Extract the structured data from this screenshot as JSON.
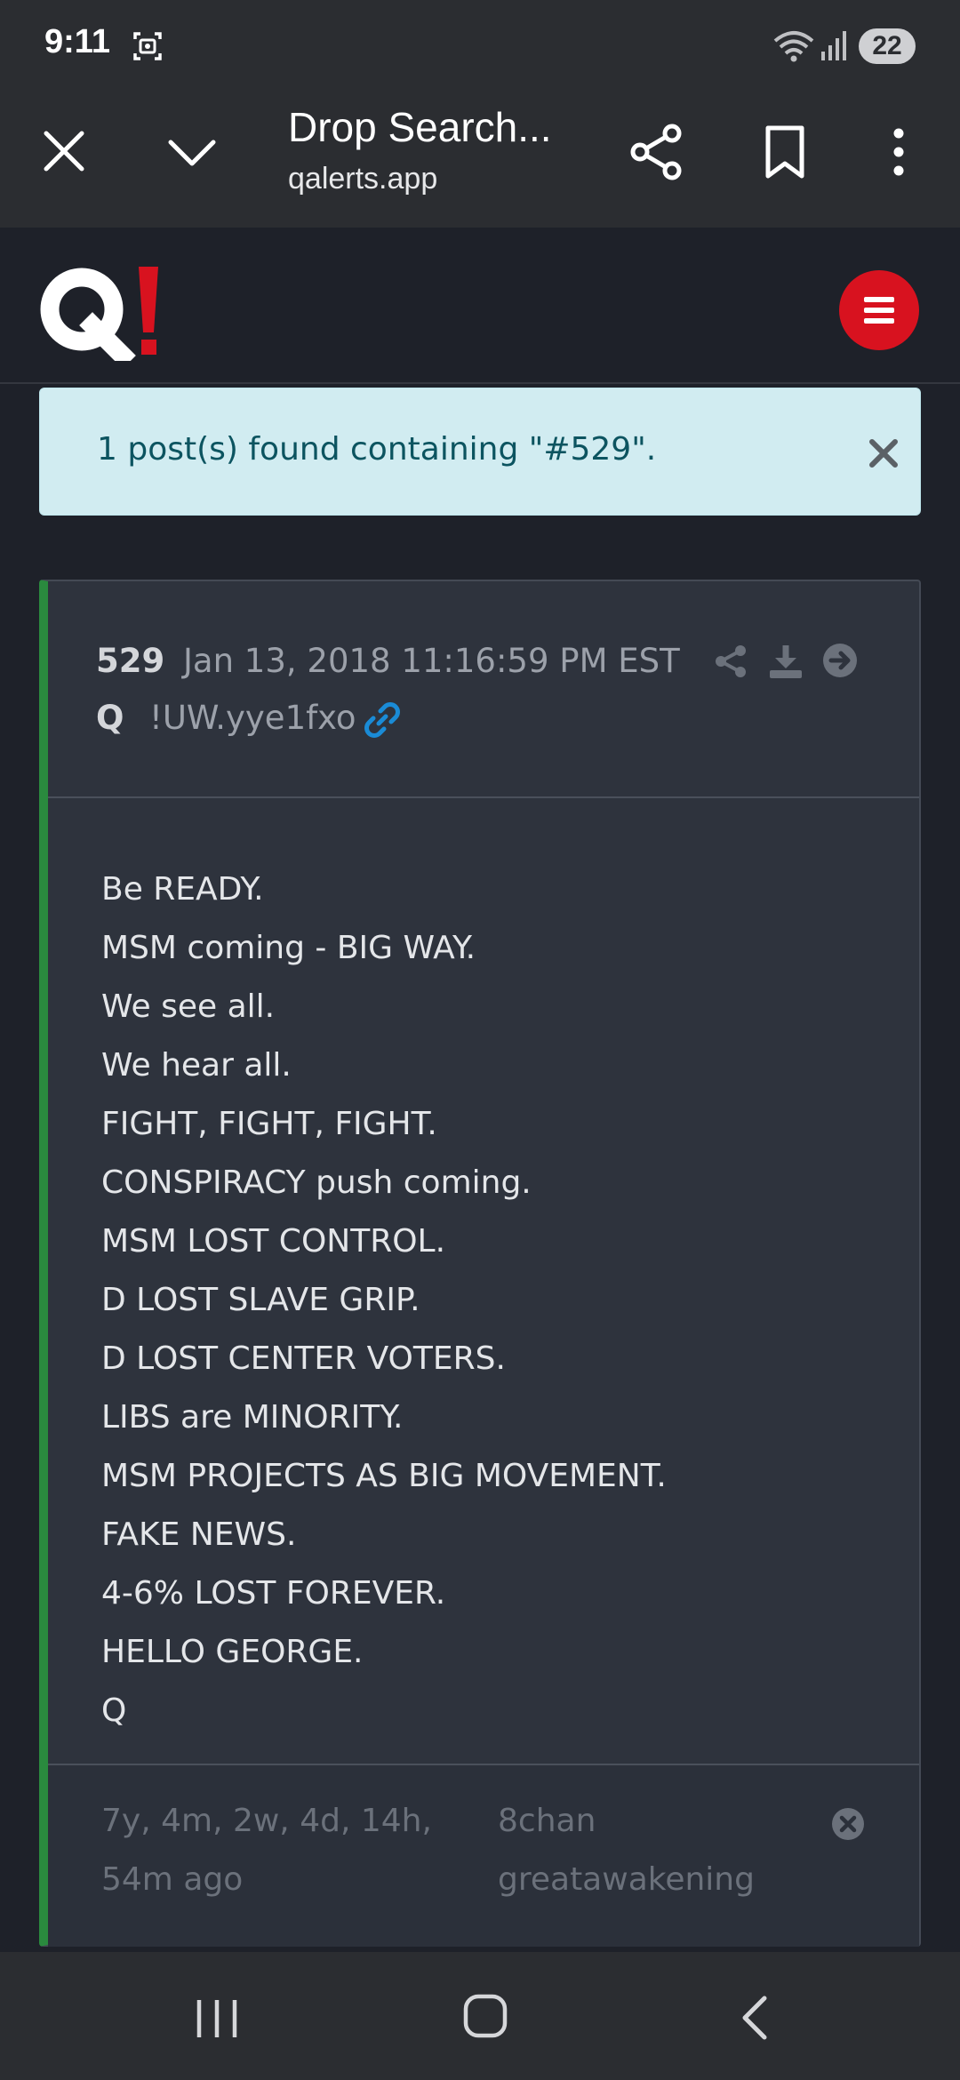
{
  "status_bar": {
    "time": "9:11",
    "battery": "22"
  },
  "browser": {
    "title": "Drop Search...",
    "url": "qalerts.app"
  },
  "alert": {
    "text": "1 post(s) found containing \"#529\"."
  },
  "post": {
    "number": "529",
    "date": "Jan 13, 2018 11:16:59 PM EST",
    "author": "Q",
    "tripcode": "!UW.yye1fxo",
    "lines": [
      "Be READY.",
      "MSM coming - BIG WAY.",
      "We see all.",
      "We hear all.",
      "FIGHT, FIGHT, FIGHT.",
      "CONSPIRACY push coming.",
      "MSM LOST CONTROL.",
      "D LOST SLAVE GRIP.",
      "D LOST CENTER VOTERS.",
      "LIBS are MINORITY.",
      "MSM PROJECTS AS BIG MOVEMENT.",
      "FAKE NEWS.",
      "4-6% LOST FOREVER.",
      "HELLO GEORGE.",
      "Q"
    ],
    "age_line1": "7y, 4m, 2w, 4d, 14h,",
    "age_line2": "54m ago",
    "source_line1": "8chan",
    "source_line2": "greatawakening"
  },
  "colors": {
    "accent_red": "#d8121f",
    "post_border_green": "#2a8a3e",
    "link_blue": "#1a8bd6",
    "alert_bg": "#d1ecf1"
  },
  "icons": {
    "browser": [
      "close-icon",
      "chevron-down-icon",
      "share-icon",
      "bookmark-icon",
      "more-vert-icon"
    ],
    "post": [
      "link-icon",
      "share-icon",
      "download-icon",
      "arrow-right-circle-icon",
      "close-circle-icon"
    ],
    "nav": [
      "recents-icon",
      "home-icon",
      "back-icon"
    ]
  }
}
